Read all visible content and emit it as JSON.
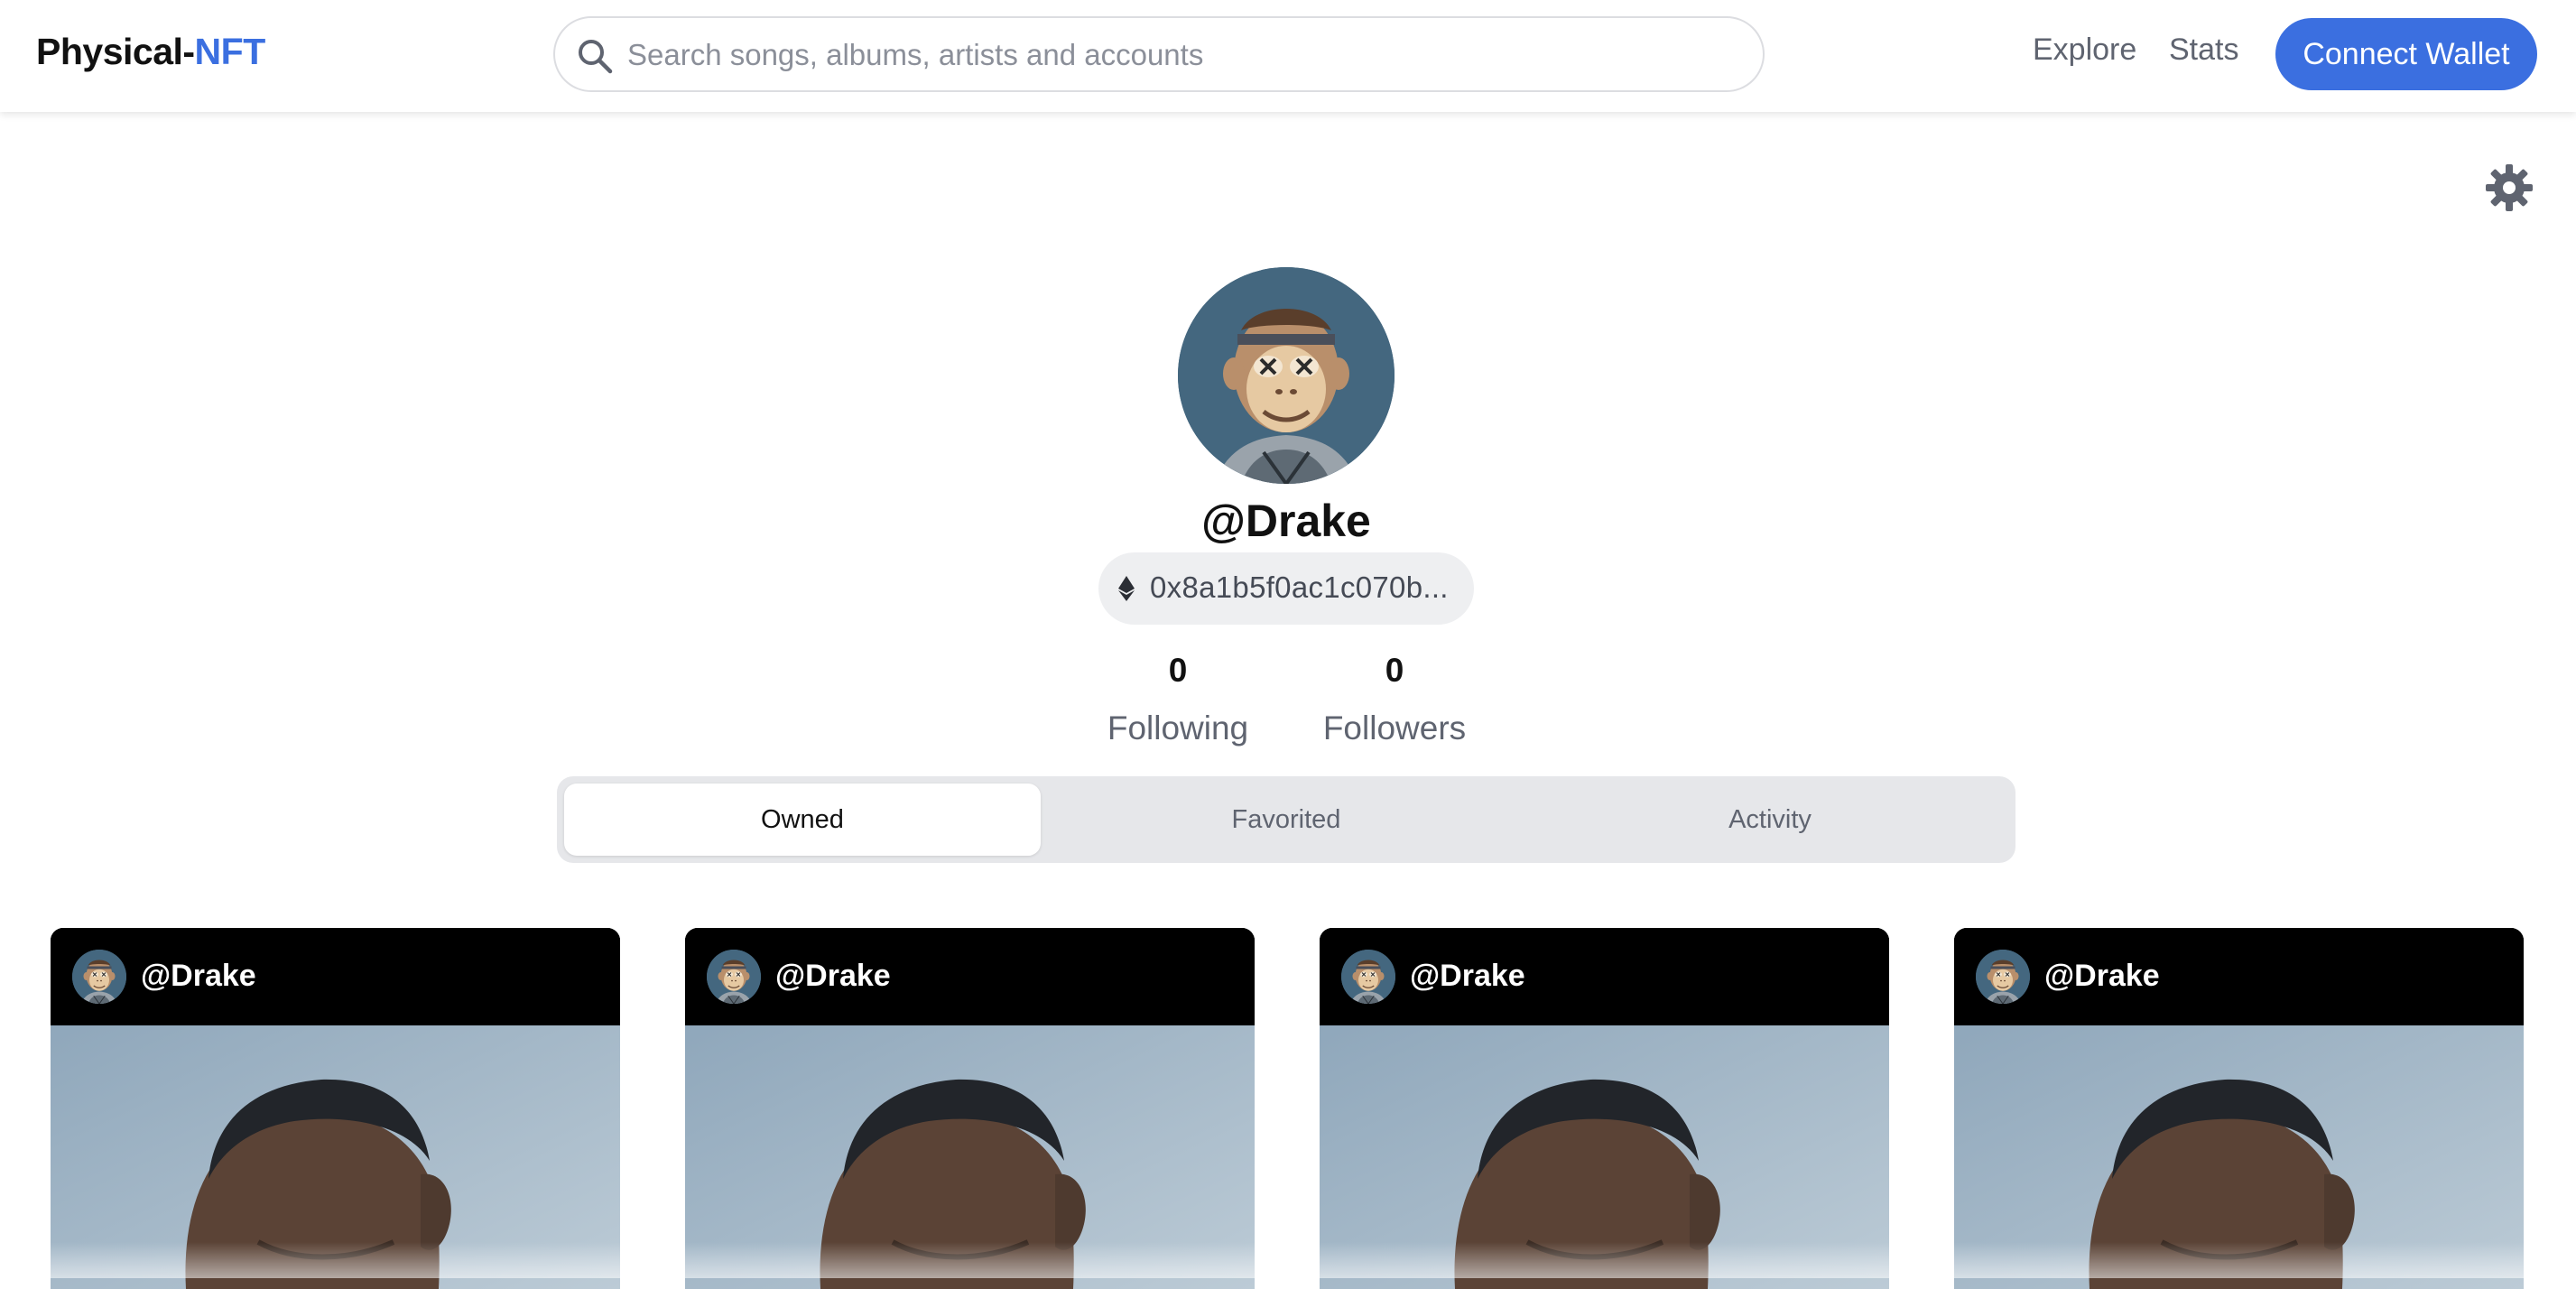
{
  "brand": {
    "name_prefix": "Physical-",
    "name_accent": "NFT",
    "accent_color": "#3b6fe0"
  },
  "search": {
    "placeholder": "Search songs, albums, artists and accounts",
    "value": "",
    "icon": "search-icon"
  },
  "nav": {
    "explore_label": "Explore",
    "stats_label": "Stats",
    "connect_label": "Connect Wallet"
  },
  "profile": {
    "settings_icon": "gear-icon",
    "avatar": "ape-avatar",
    "username": "@Drake",
    "address": "0x8a1b5f0ac1c070b...",
    "address_icon": "ethereum-icon",
    "following_count": "0",
    "following_label": "Following",
    "followers_count": "0",
    "followers_label": "Followers"
  },
  "tabs": [
    {
      "label": "Owned",
      "active": true
    },
    {
      "label": "Favorited",
      "active": false
    },
    {
      "label": "Activity",
      "active": false
    }
  ],
  "cards": [
    {
      "username": "@Drake"
    },
    {
      "username": "@Drake"
    },
    {
      "username": "@Drake"
    },
    {
      "username": "@Drake"
    }
  ]
}
